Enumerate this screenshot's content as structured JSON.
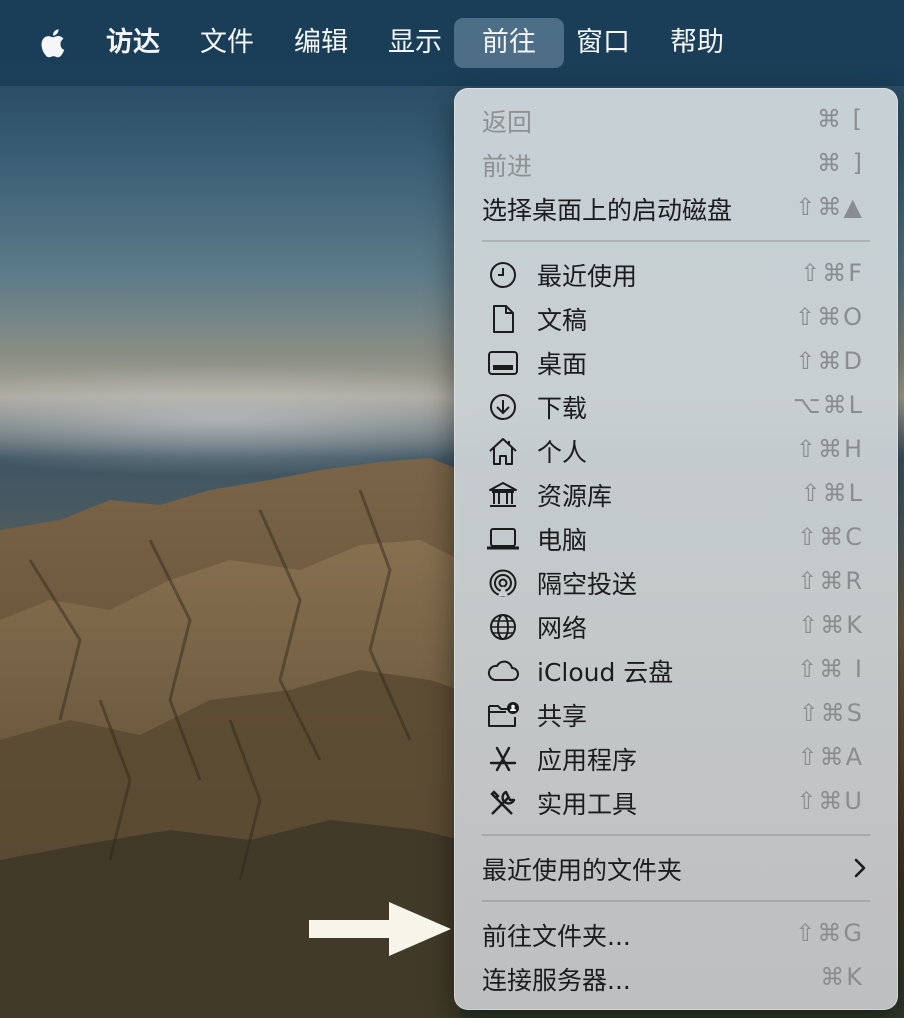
{
  "menubar": {
    "items": [
      {
        "label": "访达"
      },
      {
        "label": "文件"
      },
      {
        "label": "编辑"
      },
      {
        "label": "显示"
      },
      {
        "label": "前往",
        "active": true
      },
      {
        "label": "窗口"
      },
      {
        "label": "帮助"
      }
    ]
  },
  "go_menu": {
    "top_items": [
      {
        "label": "返回",
        "shortcut": "⌘ [",
        "disabled": true
      },
      {
        "label": "前进",
        "shortcut": "⌘ ]",
        "disabled": true
      },
      {
        "label": "选择桌面上的启动磁盘",
        "shortcut": "⇧⌘▲",
        "disabled": false
      }
    ],
    "locations": [
      {
        "label": "最近使用",
        "shortcut": "⇧⌘F",
        "icon": "clock-icon"
      },
      {
        "label": "文稿",
        "shortcut": "⇧⌘O",
        "icon": "document-icon"
      },
      {
        "label": "桌面",
        "shortcut": "⇧⌘D",
        "icon": "desktop-icon"
      },
      {
        "label": "下载",
        "shortcut": "⌥⌘L",
        "icon": "download-icon"
      },
      {
        "label": "个人",
        "shortcut": "⇧⌘H",
        "icon": "home-icon"
      },
      {
        "label": "资源库",
        "shortcut": "⇧⌘L",
        "icon": "library-icon"
      },
      {
        "label": "电脑",
        "shortcut": "⇧⌘C",
        "icon": "laptop-icon"
      },
      {
        "label": "隔空投送",
        "shortcut": "⇧⌘R",
        "icon": "airdrop-icon"
      },
      {
        "label": "网络",
        "shortcut": "⇧⌘K",
        "icon": "globe-icon"
      },
      {
        "label": "iCloud 云盘",
        "shortcut": "⇧⌘ I",
        "icon": "cloud-icon"
      },
      {
        "label": "共享",
        "shortcut": "⇧⌘S",
        "icon": "shared-folder-icon"
      },
      {
        "label": "应用程序",
        "shortcut": "⇧⌘A",
        "icon": "applications-icon"
      },
      {
        "label": "实用工具",
        "shortcut": "⇧⌘U",
        "icon": "utilities-icon"
      }
    ],
    "recent_folders": {
      "label": "最近使用的文件夹"
    },
    "bottom_items": [
      {
        "label": "前往文件夹...",
        "shortcut": "⇧⌘G"
      },
      {
        "label": "连接服务器...",
        "shortcut": "⌘K"
      }
    ]
  }
}
